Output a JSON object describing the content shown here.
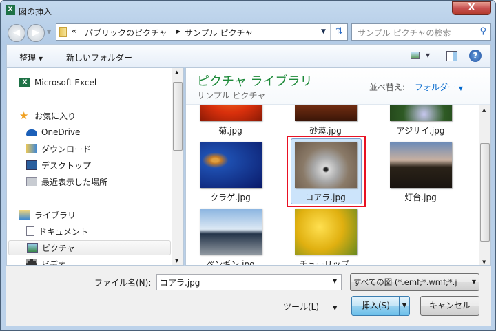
{
  "window": {
    "title": "図の挿入",
    "close": "X"
  },
  "address": {
    "overflow": "«",
    "segments": [
      "パブリックのピクチャ",
      "サンプル ピクチャ"
    ]
  },
  "search": {
    "placeholder": "サンプル ピクチャの検索"
  },
  "toolbar": {
    "organize": "整理",
    "new_folder": "新しいフォルダー"
  },
  "nav": {
    "app": "Microsoft Excel",
    "favorites": {
      "label": "お気に入り",
      "items": [
        "OneDrive",
        "ダウンロード",
        "デスクトップ",
        "最近表示した場所"
      ]
    },
    "libraries": {
      "label": "ライブラリ",
      "items": [
        "ドキュメント",
        "ピクチャ",
        "ビデオ"
      ]
    },
    "selected": "ピクチャ"
  },
  "content": {
    "title": "ピクチャ ライブラリ",
    "subtitle": "サンプル ピクチャ",
    "sort_label": "並べ替え:",
    "sort_value": "フォルダー",
    "files": [
      "菊.jpg",
      "砂漠.jpg",
      "アジサイ.jpg",
      "クラゲ.jpg",
      "コアラ.jpg",
      "灯台.jpg",
      "ペンギン.jpg",
      "チューリップ."
    ],
    "selected": "コアラ.jpg"
  },
  "footer": {
    "filename_label": "ファイル名(N):",
    "filename_value": "コアラ.jpg",
    "filter": "すべての図 (*.emf;*.wmf;*.j",
    "tools": "ツール(L)",
    "insert": "挿入(S)",
    "cancel": "キャンセル"
  },
  "colors": {
    "accent": "#0066cc",
    "title_green": "#1e8a3a",
    "highlight_red": "#e81123"
  }
}
